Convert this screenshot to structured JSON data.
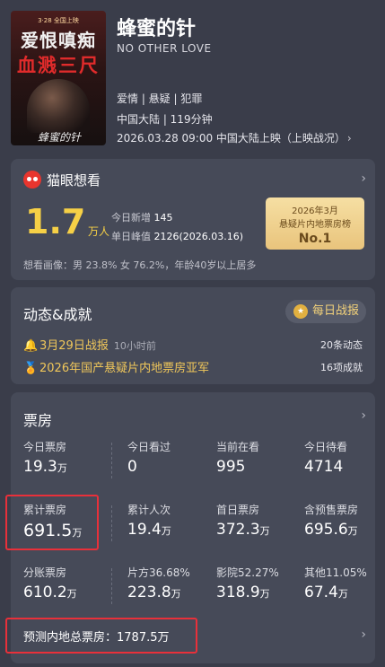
{
  "movie": {
    "title": "蜂蜜的针",
    "subtitle": "NO OTHER LOVE",
    "genre": "爱情 | 悬疑 | 犯罪",
    "region_duration": "中国大陆 | 119分钟",
    "release": "2026.03.28 09:00 中国大陆上映（上映战况）",
    "poster": {
      "top_text": "3·28 全国上映",
      "title_line1": "爱恨嗔痴",
      "title_line2": "血溅三尺",
      "signature": "蜂蜜的针"
    }
  },
  "maoyan": {
    "name": "猫眼想看",
    "score": "1.7",
    "score_unit": "万人",
    "today_new_label": "今日新增",
    "today_new_value": "145",
    "peak_label": "单日峰值",
    "peak_value": "2126(2026.03.16)",
    "rank_line1": "2026年3月",
    "rank_line2": "悬疑片内地票房榜",
    "rank_value": "No.1",
    "portrait": "想看画像：男 23.8%  女 76.2%，年龄40岁以上居多"
  },
  "dynamics": {
    "title": "动态&成就",
    "daily_button": "每日战报",
    "row1_text": "3月29日战报",
    "row1_time": "10小时前",
    "row1_right": "20条动态",
    "row2_text": "2026年国产悬疑片内地票房亚军",
    "row2_right": "16项成就"
  },
  "box_office": {
    "title": "票房",
    "row1": [
      {
        "label": "今日票房",
        "value": "19.3",
        "unit": "万"
      },
      {
        "label": "今日看过",
        "value": "0",
        "unit": ""
      },
      {
        "label": "当前在看",
        "value": "995",
        "unit": ""
      },
      {
        "label": "今日待看",
        "value": "4714",
        "unit": ""
      }
    ],
    "row2": [
      {
        "label": "累计票房",
        "value": "691.5",
        "unit": "万"
      },
      {
        "label": "累计人次",
        "value": "19.4",
        "unit": "万"
      },
      {
        "label": "首日票房",
        "value": "372.3",
        "unit": "万"
      },
      {
        "label": "含预售票房",
        "value": "695.6",
        "unit": "万"
      }
    ],
    "row3": [
      {
        "label": "分账票房",
        "value": "610.2",
        "unit": "万"
      },
      {
        "label": "片方36.68%",
        "value": "223.8",
        "unit": "万"
      },
      {
        "label": "影院52.27%",
        "value": "318.9",
        "unit": "万"
      },
      {
        "label": "其他11.05%",
        "value": "67.4",
        "unit": "万"
      }
    ],
    "forecast": "预测内地总票房：1787.5万"
  },
  "colors": {
    "background": "#3a3d4a",
    "card": "#464a58",
    "accent_yellow": "#f6d046",
    "highlight_red": "#e8303a"
  }
}
